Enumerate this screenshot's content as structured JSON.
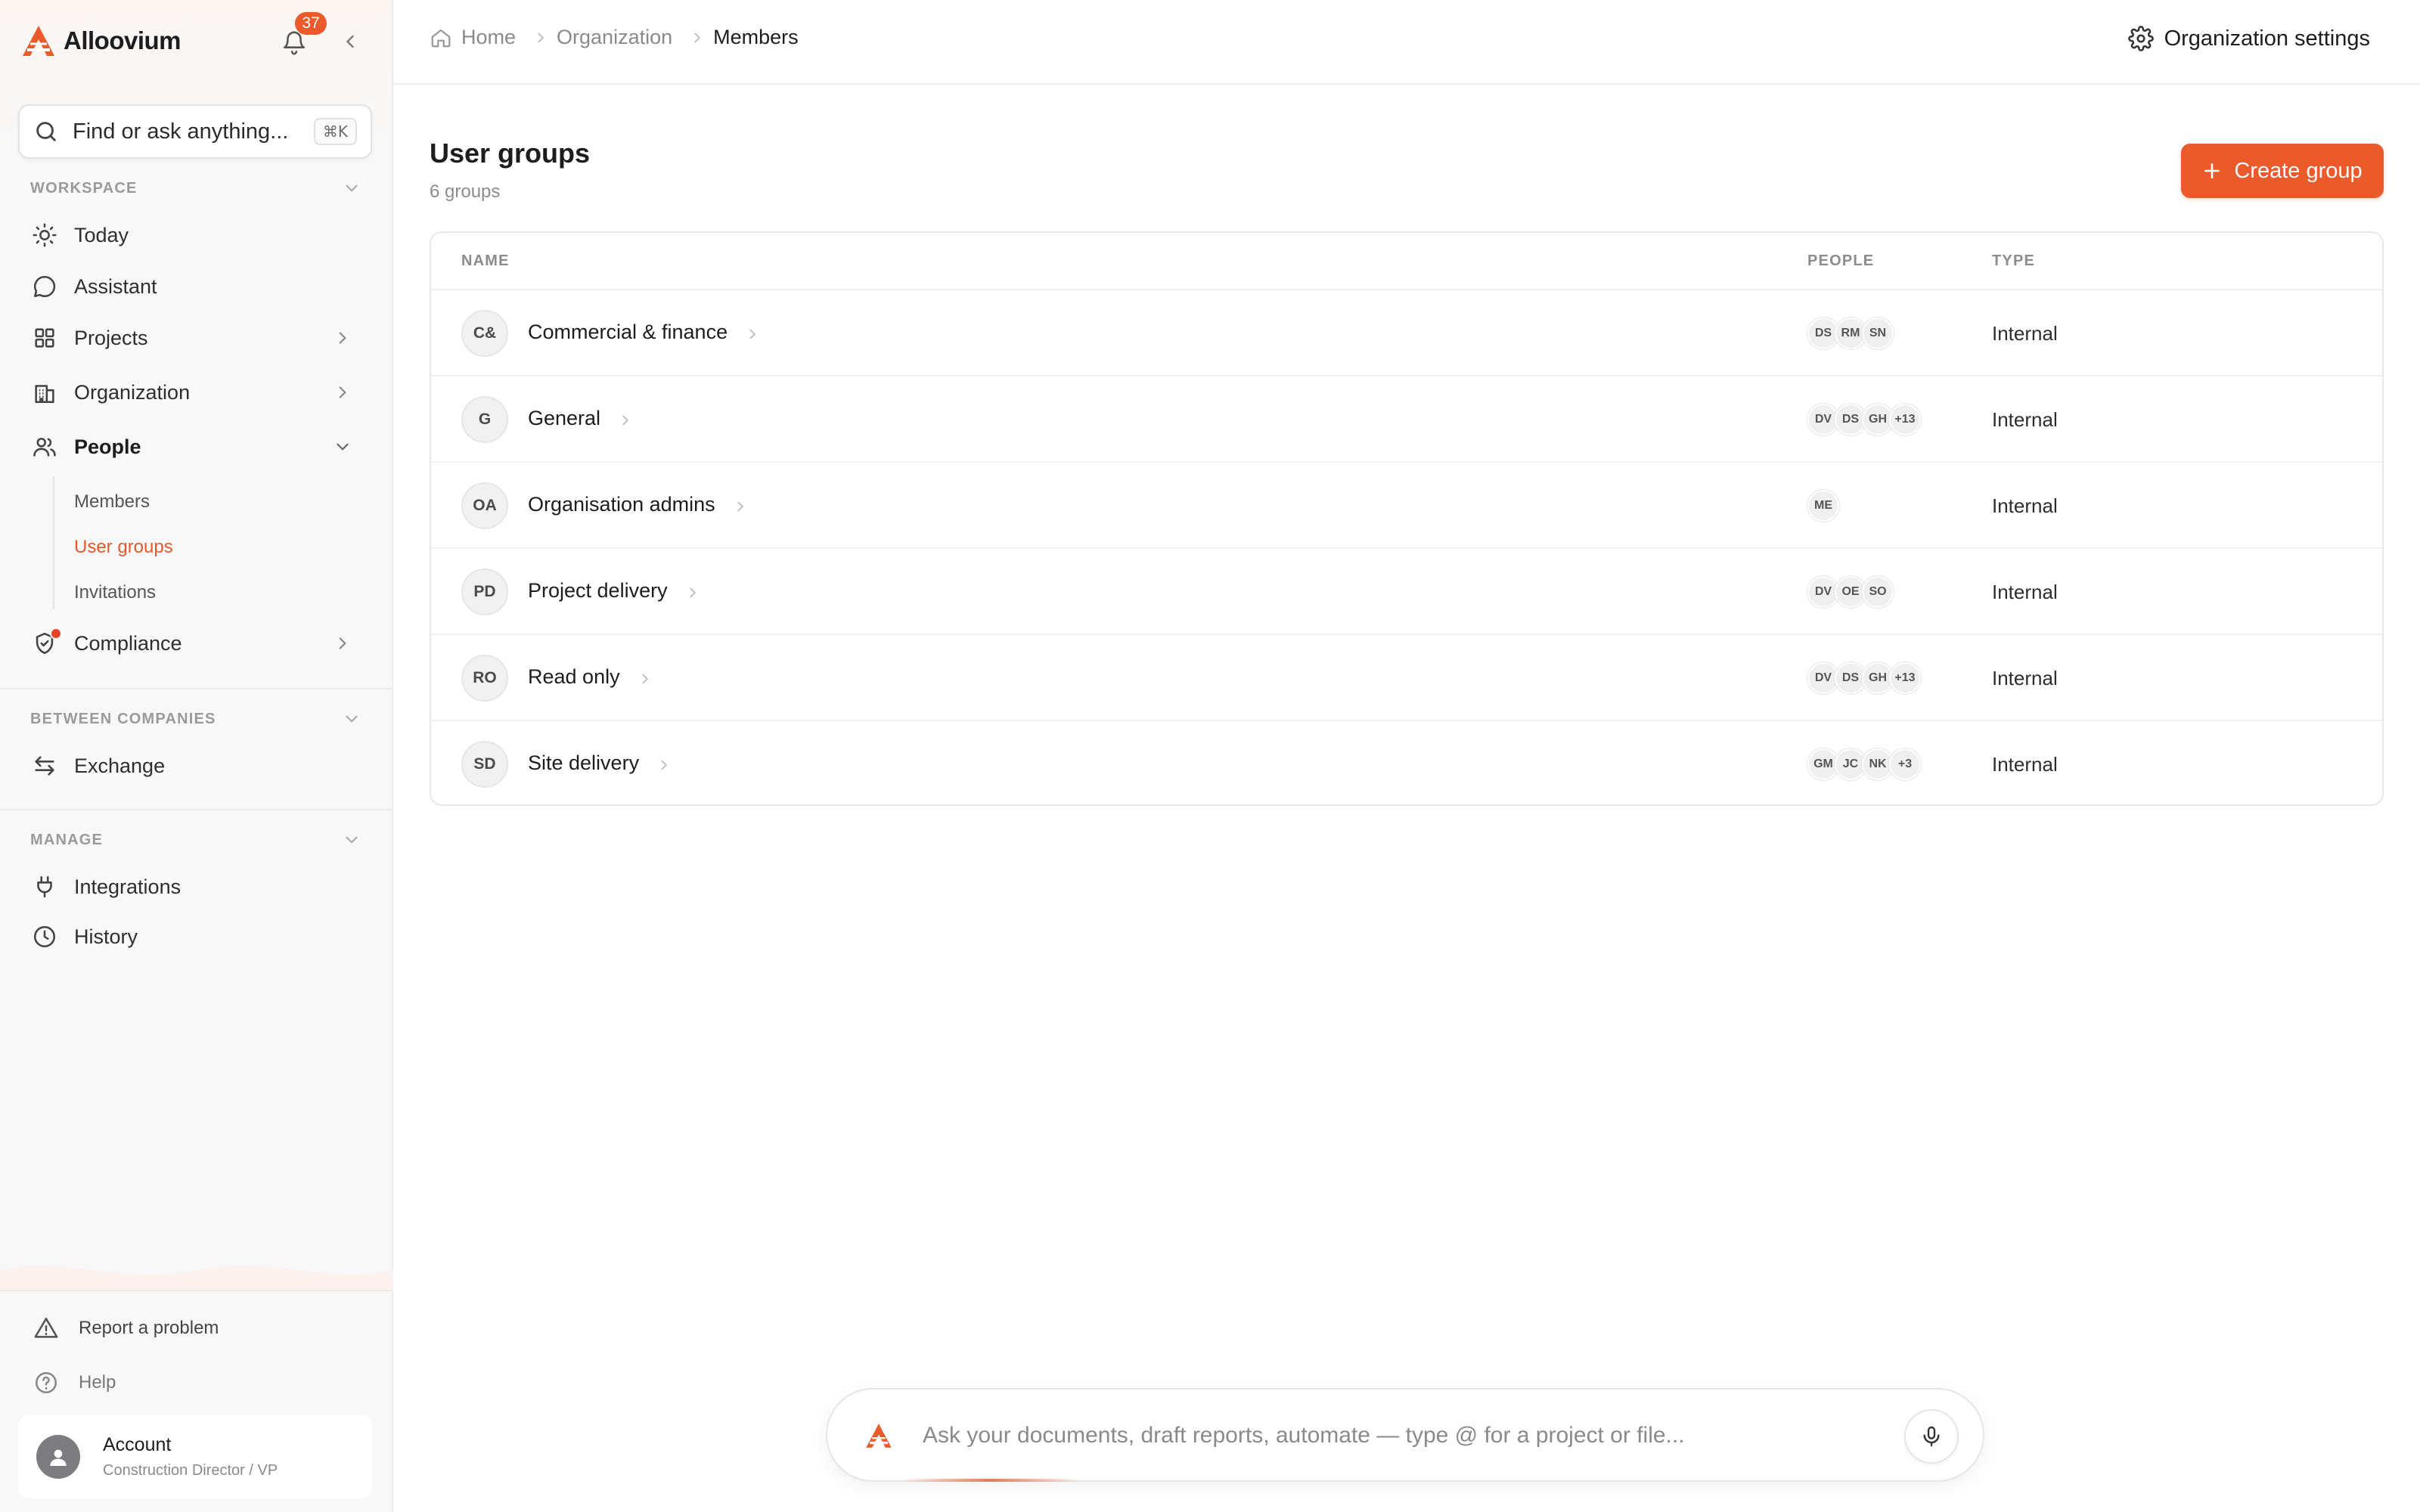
{
  "app": {
    "name": "Alloovium",
    "notification_count": "37",
    "brand_color": "#ea5a2b"
  },
  "search": {
    "placeholder": "Find or ask anything...",
    "shortcut": "⌘K"
  },
  "sidebar": {
    "workspace_label": "WORKSPACE",
    "workspace_items": [
      {
        "label": "Today",
        "icon": "sun-icon"
      },
      {
        "label": "Assistant",
        "icon": "chat-bubble-icon"
      },
      {
        "label": "Projects",
        "icon": "grid-icon"
      },
      {
        "label": "Organization",
        "icon": "building-icon"
      },
      {
        "label": "People",
        "icon": "users-icon"
      }
    ],
    "people_subitems": [
      "Members",
      "User groups",
      "Invitations"
    ],
    "compliance_label": "Compliance",
    "between_label": "BETWEEN COMPANIES",
    "exchange_label": "Exchange",
    "manage_label": "MANAGE",
    "manage_items": [
      {
        "label": "Integrations",
        "icon": "plug-icon"
      },
      {
        "label": "History",
        "icon": "clock-icon"
      }
    ],
    "report_problem": "Report a problem",
    "help": "Help",
    "account": {
      "name": "Account",
      "role": "Construction Director / VP"
    }
  },
  "breadcrumb": [
    "Home",
    "Organization",
    "Members"
  ],
  "org_settings_label": "Organization settings",
  "page": {
    "title": "User groups",
    "subtitle": "6 groups",
    "create_button": "Create group"
  },
  "table": {
    "columns": [
      "NAME",
      "PEOPLE",
      "TYPE"
    ],
    "rows": [
      {
        "initials": "C&",
        "name": "Commercial & finance",
        "people": [
          "DS",
          "RM",
          "SN"
        ],
        "type": "Internal"
      },
      {
        "initials": "G",
        "name": "General",
        "people": [
          "DV",
          "DS",
          "GH",
          "+13"
        ],
        "type": "Internal"
      },
      {
        "initials": "OA",
        "name": "Organisation admins",
        "people": [
          "ME"
        ],
        "type": "Internal"
      },
      {
        "initials": "PD",
        "name": "Project delivery",
        "people": [
          "DV",
          "OE",
          "SO"
        ],
        "type": "Internal"
      },
      {
        "initials": "RO",
        "name": "Read only",
        "people": [
          "DV",
          "DS",
          "GH",
          "+13"
        ],
        "type": "Internal"
      },
      {
        "initials": "SD",
        "name": "Site delivery",
        "people": [
          "GM",
          "JC",
          "NK",
          "+3"
        ],
        "type": "Internal"
      }
    ]
  },
  "askbar": {
    "placeholder": "Ask your documents, draft reports, automate — type @ for a project or file..."
  }
}
